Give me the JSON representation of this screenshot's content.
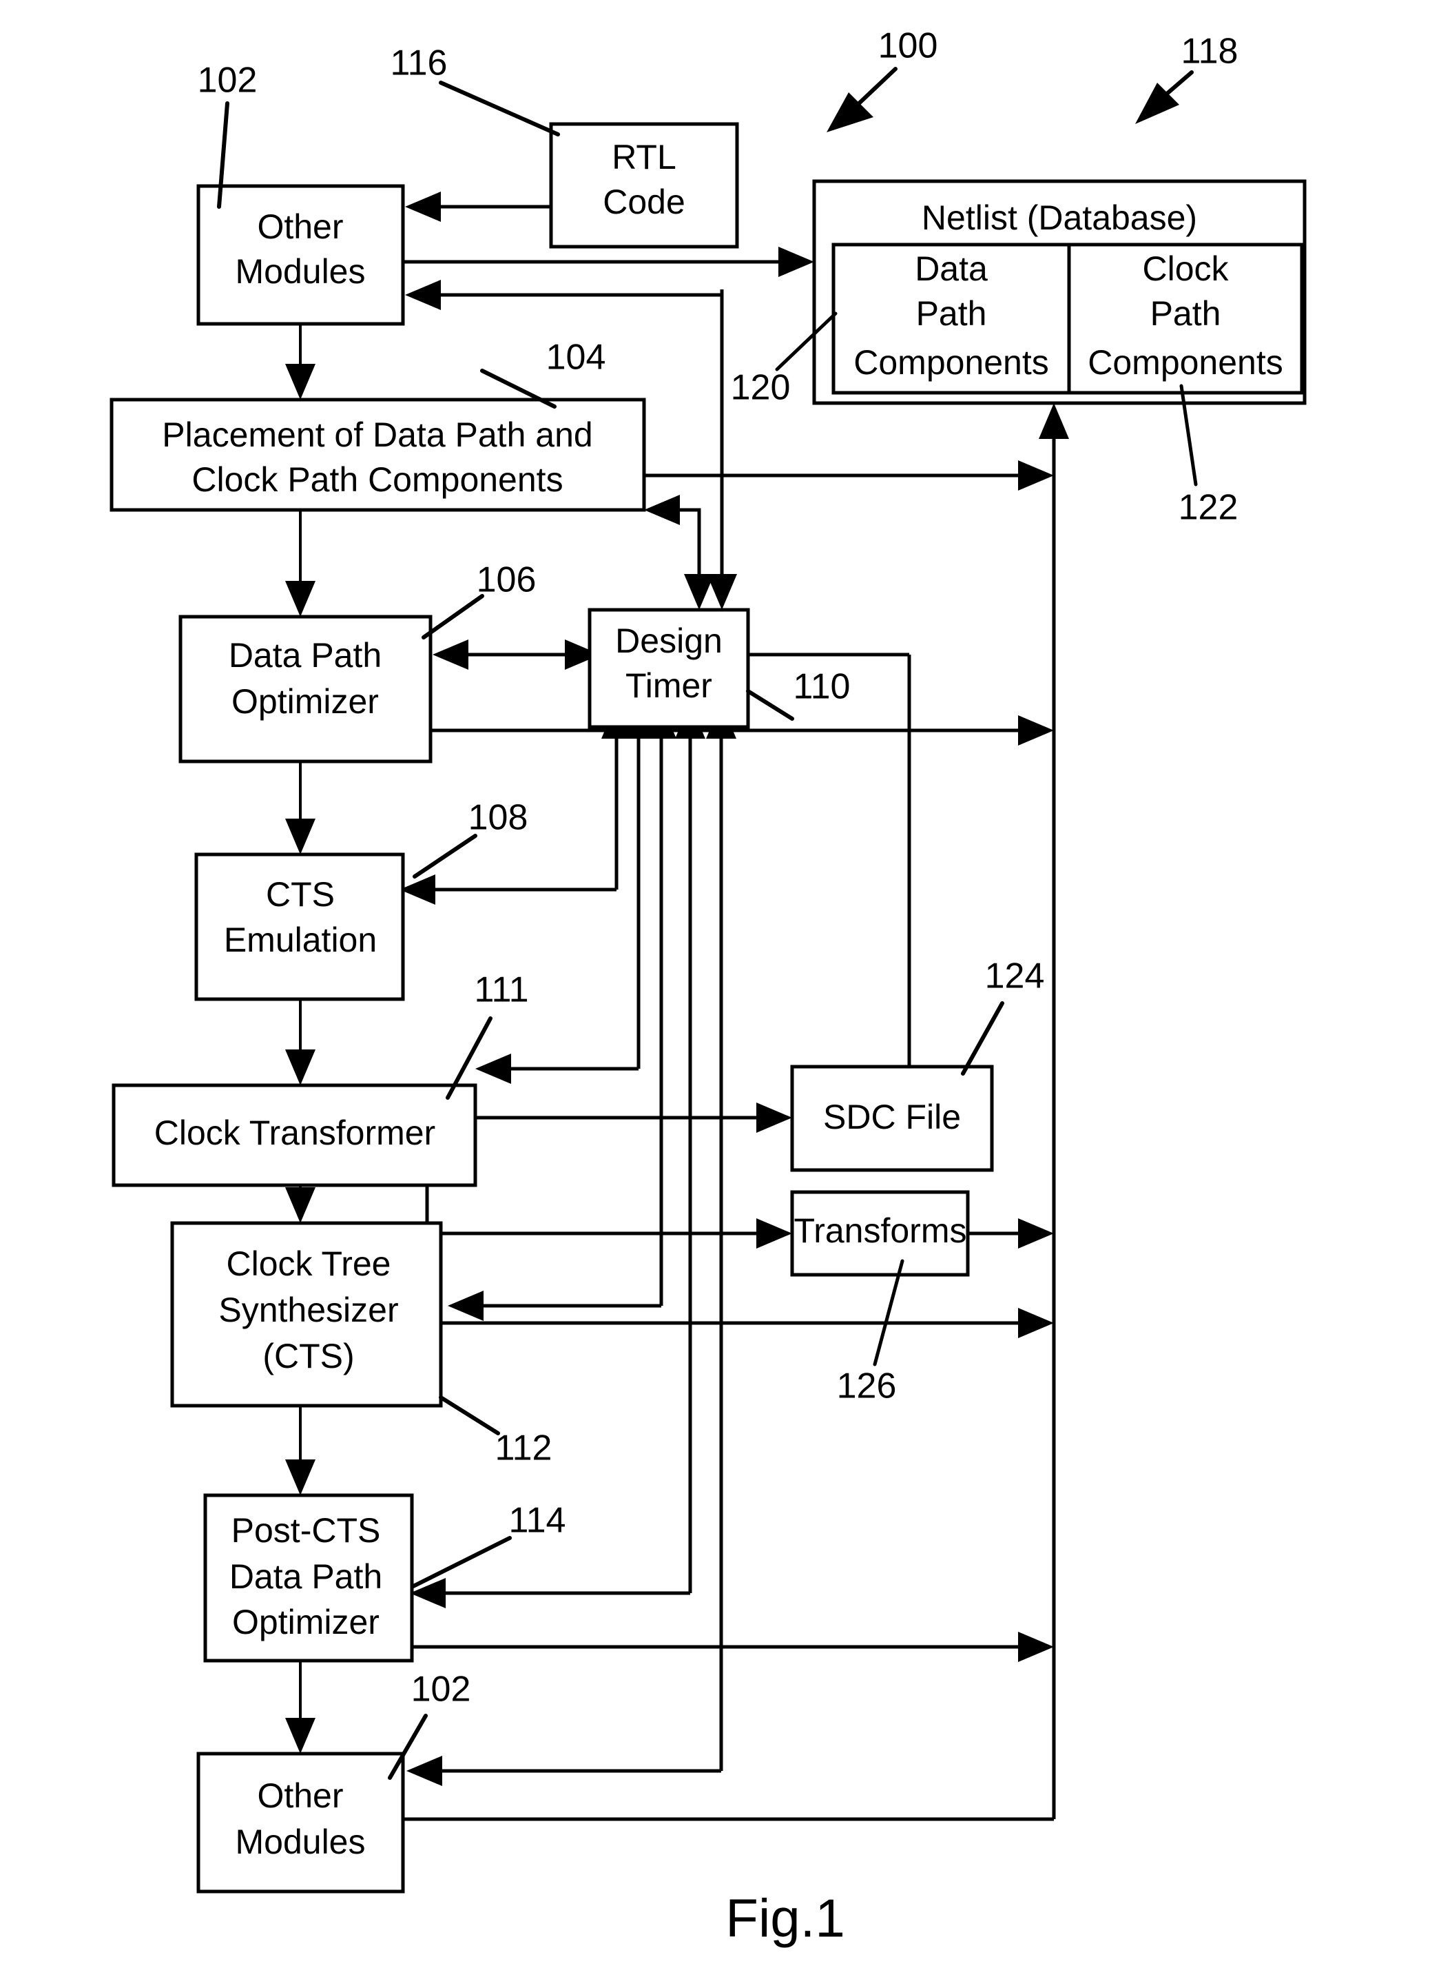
{
  "figure": {
    "caption": "Fig.1",
    "title": "Fig.1"
  },
  "blocks": {
    "other_modules_top": {
      "lines": [
        "Other",
        "Modules"
      ],
      "ref": "102"
    },
    "rtl_code": {
      "lines": [
        "RTL",
        "Code"
      ],
      "ref": "116"
    },
    "netlist": {
      "title": "Netlist (Database)",
      "ref": "118",
      "columns": [
        {
          "lines": [
            "Data",
            "Path",
            "Components"
          ],
          "ref": "120"
        },
        {
          "lines": [
            "Clock",
            "Path",
            "Components"
          ],
          "ref": "122"
        }
      ]
    },
    "placement": {
      "lines": [
        "Placement of Data Path and",
        "Clock Path Components"
      ],
      "ref": "104"
    },
    "data_path_optimizer": {
      "lines": [
        "Data Path",
        "Optimizer"
      ],
      "ref": "106"
    },
    "design_timer": {
      "lines": [
        "Design",
        "Timer"
      ],
      "ref": "110"
    },
    "cts_emulation": {
      "lines": [
        "CTS",
        "Emulation"
      ],
      "ref": "108"
    },
    "clock_transformer": {
      "lines": [
        "Clock Transformer"
      ],
      "ref": "111"
    },
    "sdc_file": {
      "lines": [
        "SDC File"
      ],
      "ref": "124"
    },
    "transforms": {
      "lines": [
        "Transforms"
      ],
      "ref": "126"
    },
    "clock_tree_synthesizer": {
      "lines": [
        "Clock Tree",
        "Synthesizer",
        "(CTS)"
      ],
      "ref": "112"
    },
    "post_cts_optimizer": {
      "lines": [
        "Post-CTS",
        "Data Path",
        "Optimizer"
      ],
      "ref": "114"
    },
    "other_modules_bottom": {
      "lines": [
        "Other",
        "Modules"
      ],
      "ref": "102"
    }
  },
  "system_ref": "100",
  "colors": {
    "line": "#000000",
    "fill": "#ffffff",
    "background": "#ffffff"
  }
}
